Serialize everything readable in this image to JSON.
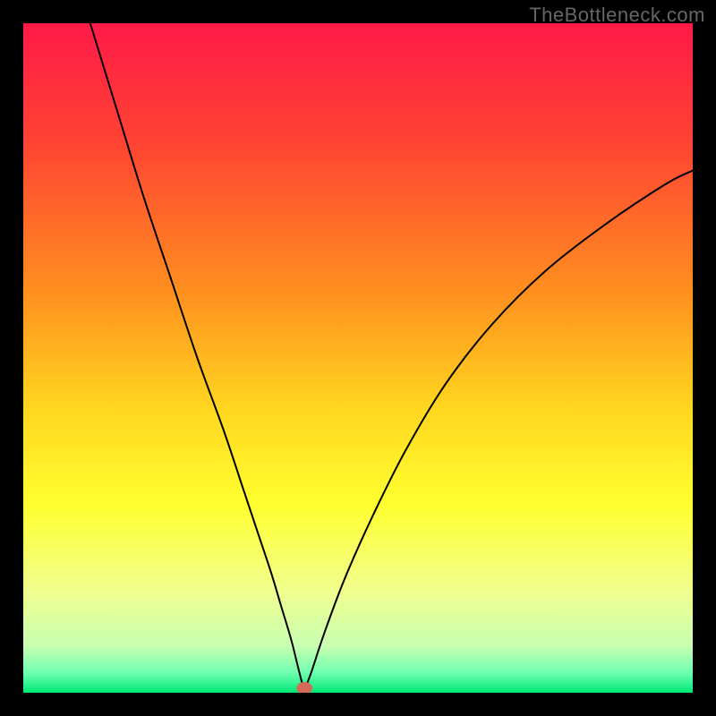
{
  "watermark": "TheBottleneck.com",
  "chart_data": {
    "type": "line",
    "title": "",
    "xlabel": "",
    "ylabel": "",
    "xlim": [
      0,
      100
    ],
    "ylim": [
      0,
      100
    ],
    "grid": false,
    "legend": false,
    "background_gradient_stops": [
      {
        "offset": 0.0,
        "color": "#ff1a48"
      },
      {
        "offset": 0.18,
        "color": "#ff4433"
      },
      {
        "offset": 0.4,
        "color": "#ff8f1f"
      },
      {
        "offset": 0.58,
        "color": "#ffd81f"
      },
      {
        "offset": 0.72,
        "color": "#ffff2f"
      },
      {
        "offset": 0.85,
        "color": "#f0ff90"
      },
      {
        "offset": 0.93,
        "color": "#c8ffb0"
      },
      {
        "offset": 0.97,
        "color": "#70ffb0"
      },
      {
        "offset": 1.0,
        "color": "#00e878"
      }
    ],
    "series": [
      {
        "name": "bottleneck-curve",
        "color": "#000000",
        "x": [
          10,
          14,
          18,
          22,
          26,
          30,
          33,
          35,
          37,
          38.5,
          40,
          41,
          41.8,
          42.2,
          43,
          45,
          48,
          52,
          57,
          63,
          70,
          78,
          87,
          96,
          100
        ],
        "y": [
          100,
          87,
          74,
          62,
          50,
          39,
          30,
          24,
          18,
          13,
          8,
          4,
          1,
          1,
          3,
          9,
          17,
          26,
          36,
          46,
          55,
          63,
          70,
          76,
          78
        ]
      }
    ],
    "marker": {
      "x": 42,
      "y": 0.7,
      "color": "#d46a5a",
      "rx": 1.2,
      "ry": 0.9
    }
  }
}
